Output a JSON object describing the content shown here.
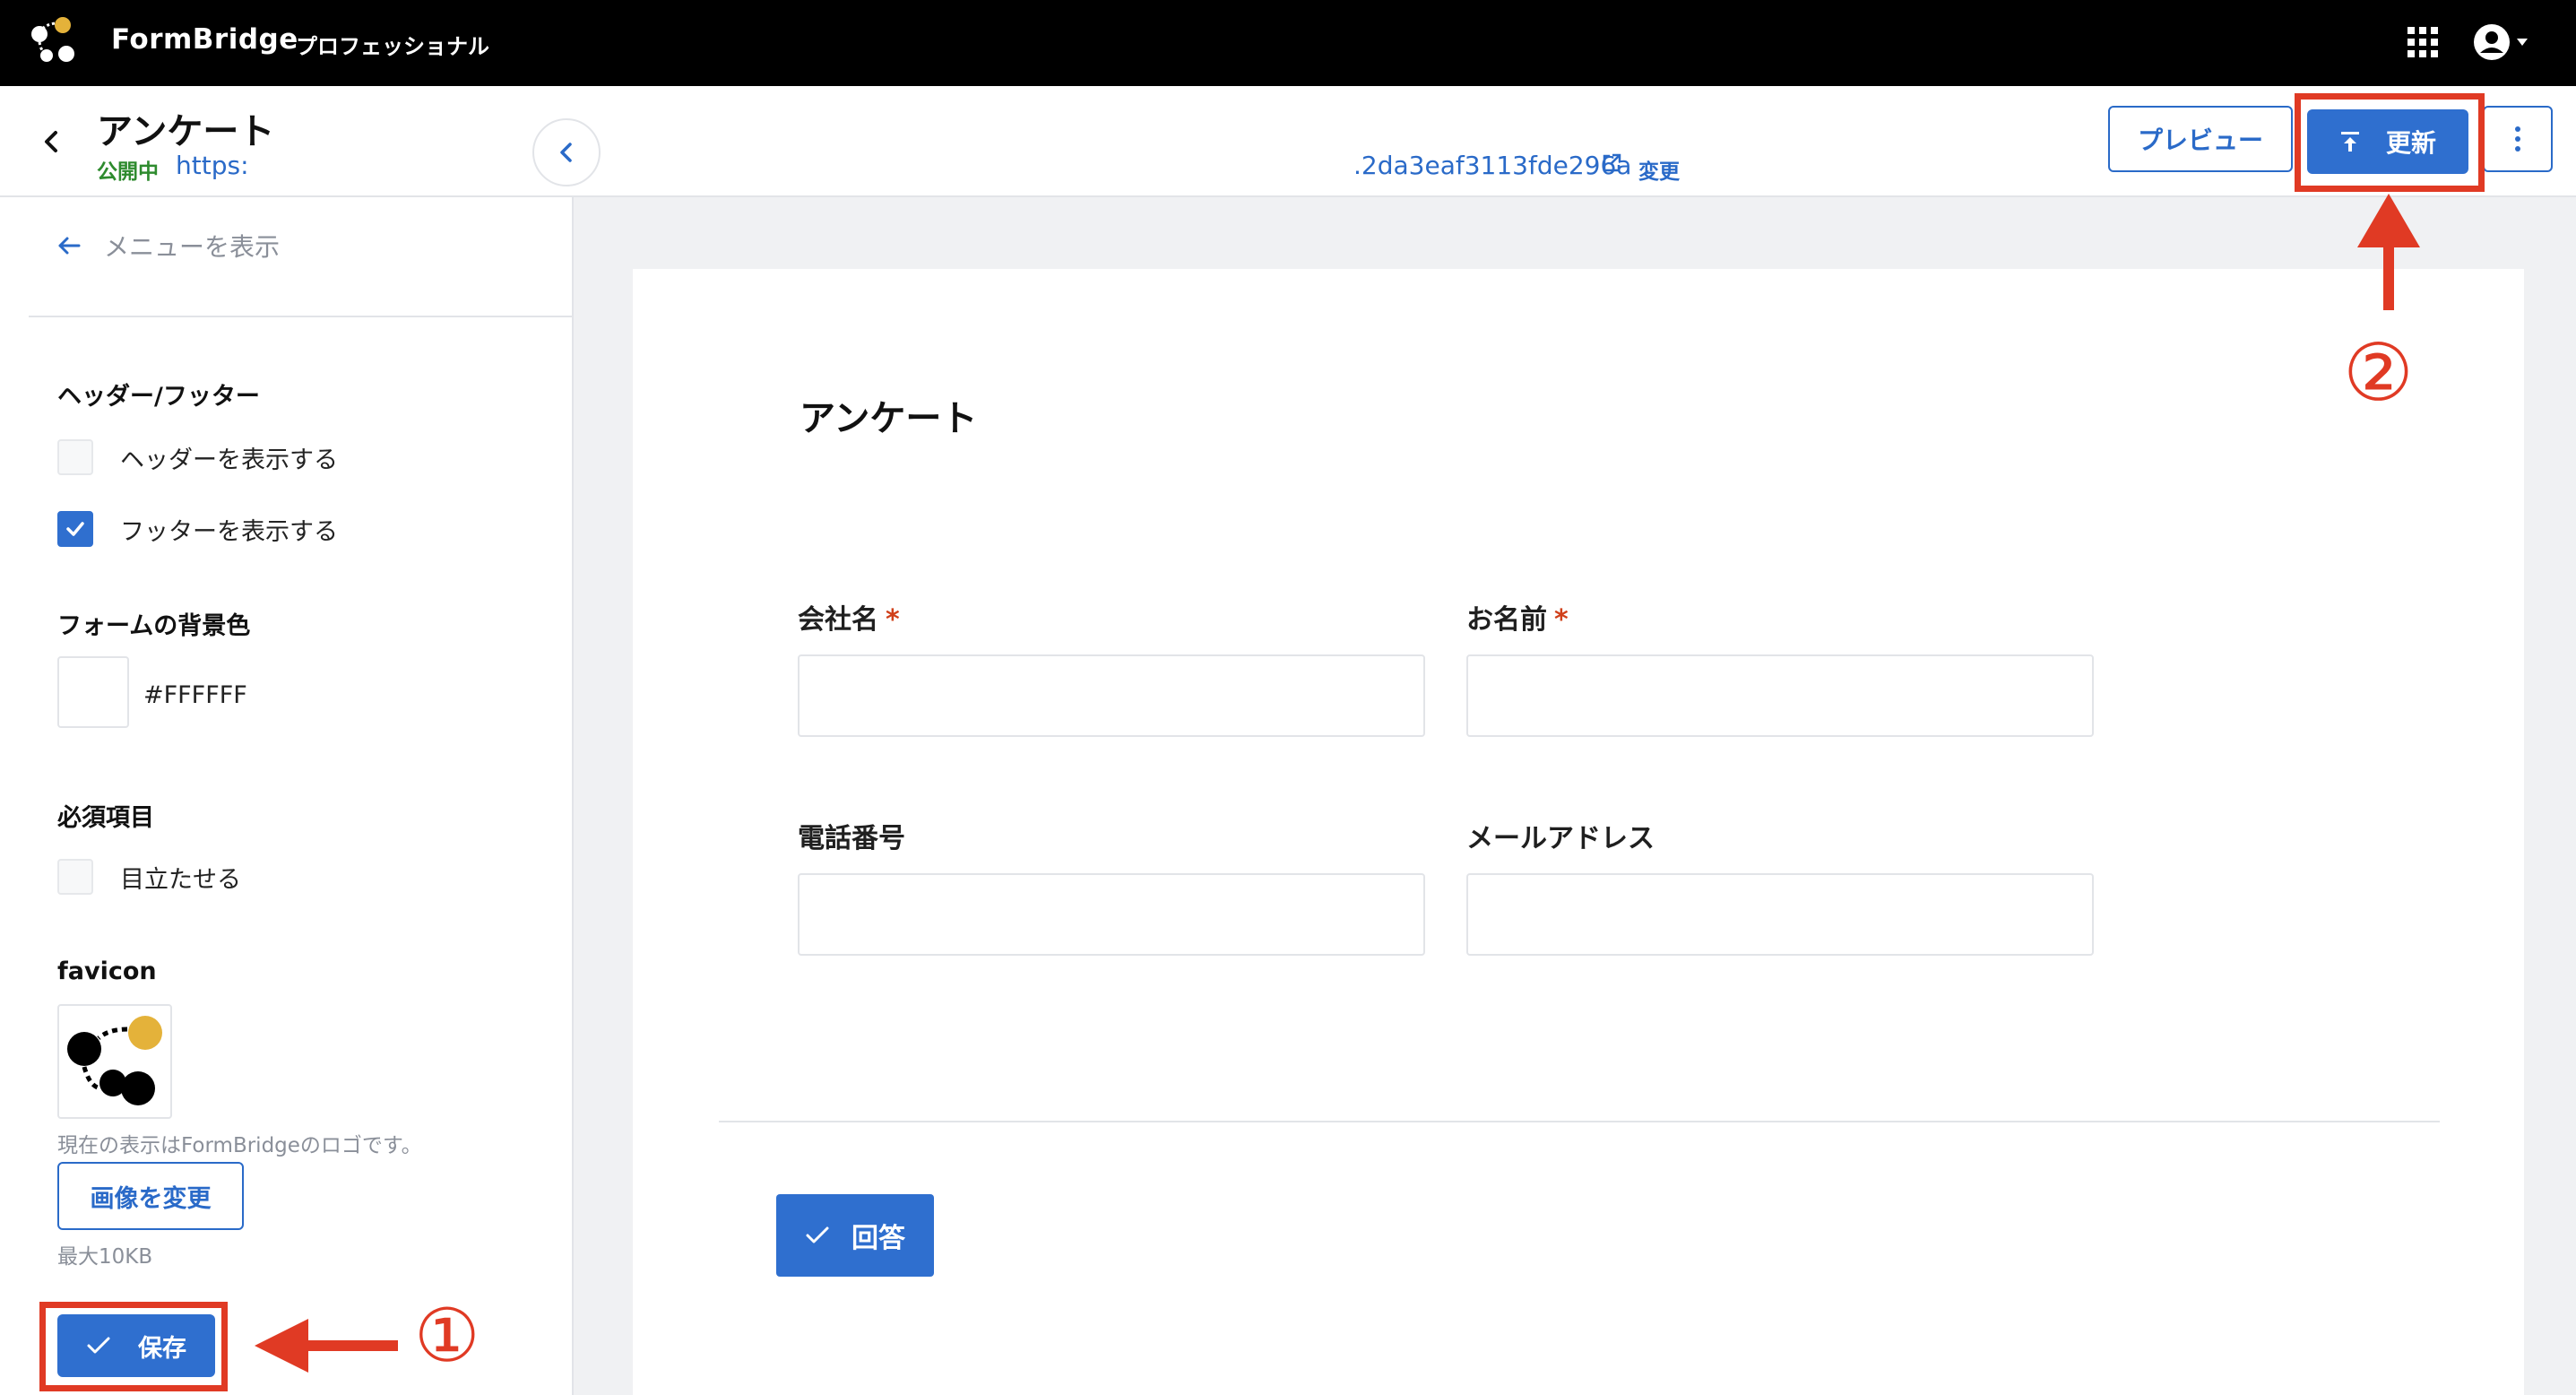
{
  "app": {
    "brand": "FormBridge",
    "edition": "プロフェッショナル"
  },
  "header": {
    "form_title": "アンケート",
    "status": "公開中",
    "url_start": "https:",
    "url_end": ".2da3eaf3113fde296a",
    "change_link": "変更",
    "preview_button": "プレビュー",
    "update_button": "更新"
  },
  "sidebar": {
    "show_menu": "メニューを表示",
    "header_footer": {
      "title": "ヘッダー/フッター",
      "show_header": "ヘッダーを表示する",
      "show_header_checked": false,
      "show_footer": "フッターを表示する",
      "show_footer_checked": true
    },
    "background": {
      "title": "フォームの背景色",
      "value": "#FFFFFF"
    },
    "required": {
      "title": "必須項目",
      "highlight": "目立たせる",
      "highlight_checked": false
    },
    "favicon": {
      "title": "favicon",
      "note": "現在の表示はFormBridgeのロゴです。",
      "change_button": "画像を変更",
      "max_size": "最大10KB"
    },
    "save_button": "保存"
  },
  "annotations": {
    "step1": "①",
    "step2": "②"
  },
  "preview": {
    "title": "アンケート",
    "fields": [
      {
        "label": "会社名",
        "required_mark": "*"
      },
      {
        "label": "お名前",
        "required_mark": "*"
      },
      {
        "label": "電話番号"
      },
      {
        "label": "メールアドレス"
      }
    ],
    "submit_button": "回答"
  },
  "colors": {
    "accent": "#2f6fcf",
    "annotation": "#e03a24",
    "published": "#2e8b2e",
    "logo_yellow": "#e4b23a"
  },
  "icons": [
    "formbridge-logo-icon",
    "apps-grid-icon",
    "account-icon",
    "back-arrow-icon",
    "external-link-icon",
    "upload-icon",
    "more-vert-icon",
    "arrow-left-icon",
    "chevron-left-icon",
    "check-icon"
  ]
}
